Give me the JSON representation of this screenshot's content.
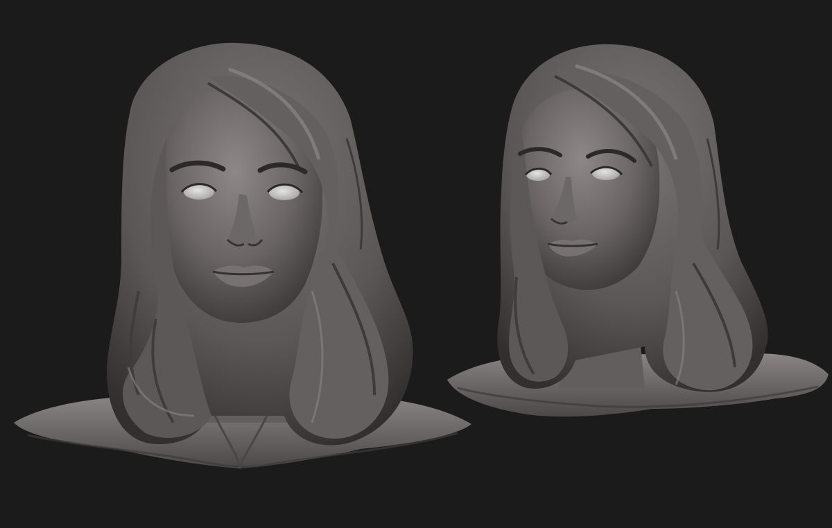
{
  "scene": {
    "background_color": "#1c1b1c",
    "material_color": "#6e6a69",
    "material_highlight": "#9a9594",
    "material_shadow": "#2f2c2c",
    "eye_color": "#cfcfcf",
    "views": [
      {
        "name": "front-view"
      },
      {
        "name": "three-quarter-view"
      }
    ]
  }
}
